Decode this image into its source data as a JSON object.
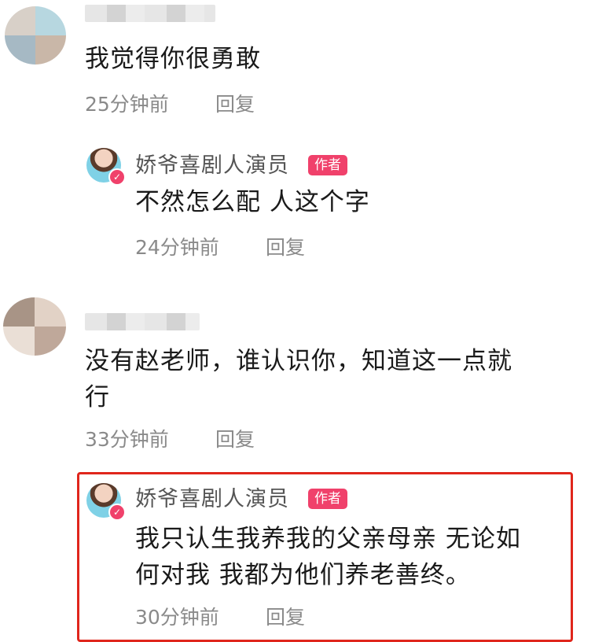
{
  "comments": [
    {
      "text": "我觉得你很勇敢",
      "time": "25分钟前",
      "reply_label": "回复",
      "reply": {
        "author": "娇爷喜剧人演员",
        "badge": "作者",
        "text": "不然怎么配 人这个字",
        "time": "24分钟前",
        "reply_label": "回复"
      }
    },
    {
      "text_line1": "没有赵老师，谁认识你，知道这一点就",
      "text_line2": "行",
      "time": "33分钟前",
      "reply_label": "回复",
      "reply": {
        "author": "娇爷喜剧人演员",
        "badge": "作者",
        "text_line1": "我只认生我养我的父亲母亲 无论如",
        "text_line2": "何对我 我都为他们养老善终。",
        "time": "30分钟前",
        "reply_label": "回复"
      }
    }
  ],
  "colors": {
    "badge": "#f0416b",
    "highlight_border": "#e0261c",
    "meta_text": "#8a8a8a"
  },
  "icons": [
    "verified-check-icon"
  ]
}
